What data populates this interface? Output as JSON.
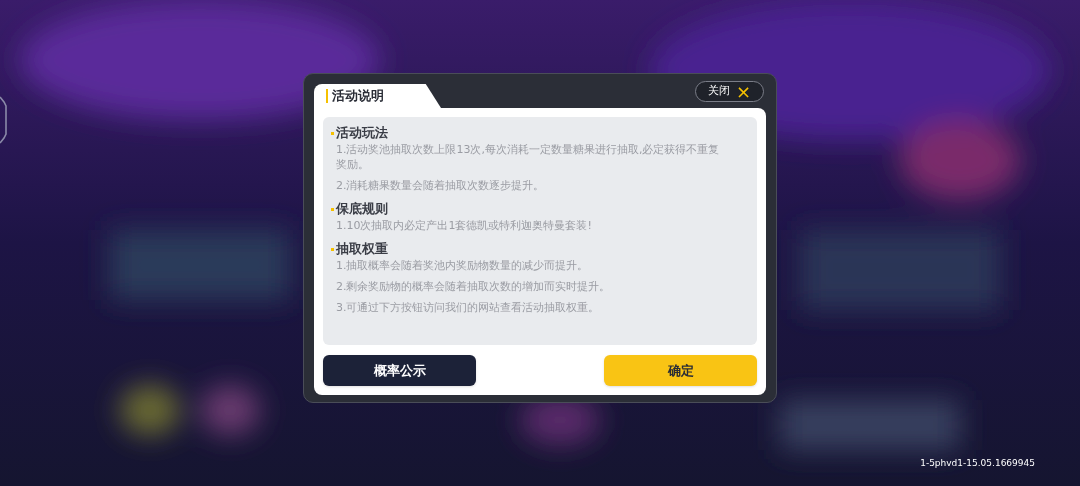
{
  "dialog": {
    "title": "活动说明",
    "close_button": {
      "label": "关闭",
      "icon": "×"
    },
    "sections": [
      {
        "heading": "活动玩法",
        "items": [
          "1.活动奖池抽取次数上限13次,每次消耗一定数量糖果进行抽取,必定获得不重复奖励。",
          "2.消耗糖果数量会随着抽取次数逐步提升。"
        ]
      },
      {
        "heading": "保底规则",
        "items": [
          "1.10次抽取内必定产出1套德凯或特利迦奥特曼套装!"
        ]
      },
      {
        "heading": "抽取权重",
        "items": [
          "1.抽取概率会随着奖池内奖励物数量的减少而提升。",
          "2.剩余奖励物的概率会随着抽取次数的增加而实时提升。",
          "3.可通过下方按钮访问我们的网站查看活动抽取权重。"
        ]
      }
    ],
    "buttons": [
      {
        "label": "概率公示",
        "kind": "secondary"
      },
      {
        "label": "确定",
        "kind": "primary"
      }
    ]
  },
  "version": "1-5phvd1-15.05.1669945"
}
